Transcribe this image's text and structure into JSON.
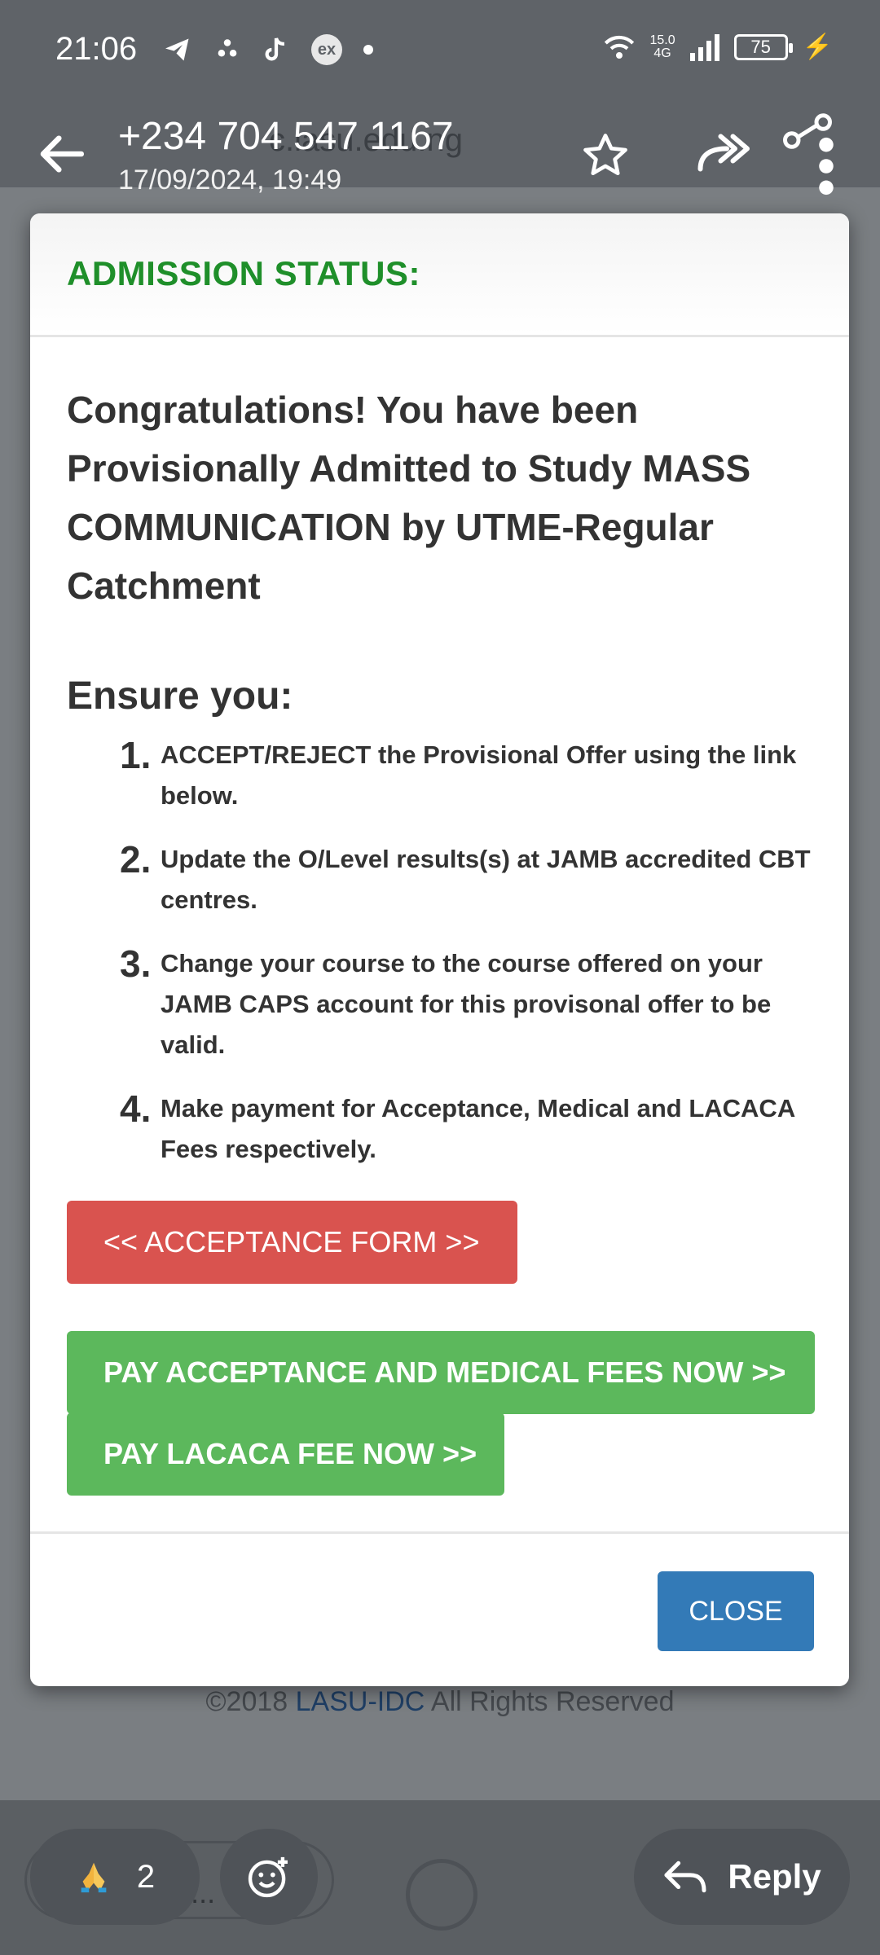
{
  "status_bar": {
    "time": "21:06",
    "network_speed": "15.0",
    "network_type": "4G",
    "battery_level": "75"
  },
  "viewer": {
    "sender": "+234 704 547 1167",
    "date": "17/09/2024, 19:49"
  },
  "background_page": {
    "url_fragment": "c.lasu.edu.ng",
    "footer_copyright": "©2018 ",
    "footer_link": "LASU-IDC",
    "footer_rest": " All Rights Reserved",
    "search_placeholder": "Search..."
  },
  "dialog": {
    "title": "ADMISSION STATUS:",
    "message": "Congratulations! You have been Provisionally Admitted to Study MASS COMMUNICATION by UTME-Regular Catchment",
    "ensure_heading": "Ensure you:",
    "steps": [
      {
        "num": "1.",
        "text": "ACCEPT/REJECT the Provisional Offer using the link below."
      },
      {
        "num": "2.",
        "text": "Update the O/Level results(s) at JAMB accredited CBT centres."
      },
      {
        "num": "3.",
        "text": "Change your course to the course offered on your JAMB CAPS account for this provisonal offer to be valid."
      },
      {
        "num": "4.",
        "text": "Make payment for Acceptance, Medical and LACACA Fees respectively."
      }
    ],
    "acceptance_button": "<< ACCEPTANCE FORM >>",
    "pay_acceptance_button": "PAY ACCEPTANCE AND MEDICAL FEES NOW >>",
    "pay_lacaca_button": "PAY LACACA FEE NOW >>",
    "close_button": "CLOSE"
  },
  "bottom_actions": {
    "reaction_count": "2",
    "reply_label": "Reply"
  },
  "colors": {
    "title_green": "#1f8f2a",
    "danger_red": "#d9534f",
    "success_green": "#5cb85c",
    "primary_blue": "#337ab7"
  }
}
